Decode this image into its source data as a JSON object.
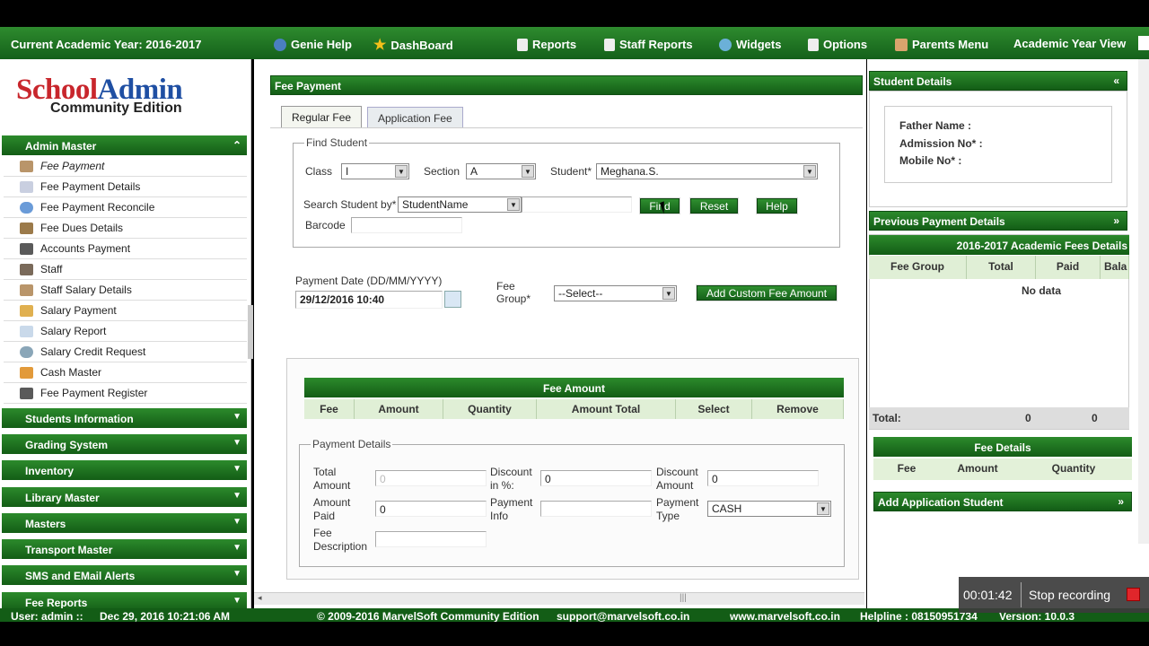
{
  "topbar": {
    "academic_year": "Current Academic Year: 2016-2017",
    "items": [
      {
        "label": "Genie Help",
        "icon": "genie-icon"
      },
      {
        "label": "DashBoard",
        "icon": "star-icon"
      },
      {
        "label": "Reports",
        "icon": "document-icon"
      },
      {
        "label": "Staff Reports",
        "icon": "document-icon"
      },
      {
        "label": "Widgets",
        "icon": "widget-icon"
      },
      {
        "label": "Options",
        "icon": "document-icon"
      },
      {
        "label": "Parents Menu",
        "icon": "parents-icon"
      },
      {
        "label": "Academic Year View",
        "icon": ""
      }
    ]
  },
  "logo": {
    "school": "School",
    "admin": "Admin",
    "edition": "Community Edition"
  },
  "sidebar": {
    "open_section": "Admin Master",
    "items": [
      {
        "label": "Fee Payment"
      },
      {
        "label": "Fee Payment Details"
      },
      {
        "label": "Fee Payment Reconcile"
      },
      {
        "label": "Fee Dues Details"
      },
      {
        "label": "Accounts Payment"
      },
      {
        "label": "Staff"
      },
      {
        "label": "Staff Salary Details"
      },
      {
        "label": "Salary Payment"
      },
      {
        "label": "Salary Report"
      },
      {
        "label": "Salary Credit Request"
      },
      {
        "label": "Cash Master"
      },
      {
        "label": "Fee Payment Register"
      }
    ],
    "sections": [
      "Students Information",
      "Grading System",
      "Inventory",
      "Library Master",
      "Masters",
      "Transport Master",
      "SMS and EMail Alerts",
      "Fee Reports"
    ]
  },
  "fee_payment": {
    "title": "Fee Payment",
    "tabs": [
      "Regular Fee",
      "Application Fee"
    ],
    "find_student": {
      "legend": "Find Student",
      "class_label": "Class",
      "class_value": "I",
      "section_label": "Section",
      "section_value": "A",
      "student_label": "Student*",
      "student_value": "Meghana.S.",
      "search_by_label": "Search Student by*",
      "search_by_value": "StudentName",
      "search_text": "",
      "find_button": "Find",
      "reset_button": "Reset",
      "help_button": "Help",
      "barcode_label": "Barcode",
      "barcode_value": ""
    },
    "payment_date_label": "Payment Date (DD/MM/YYYY)",
    "payment_date_value": "29/12/2016 10:40",
    "fee_group_label": "Fee Group*",
    "fee_group_value": "--Select--",
    "custom_fee_button": "Add Custom Fee Amount",
    "fee_amount_table": {
      "title": "Fee Amount",
      "columns": [
        "Fee",
        "Amount",
        "Quantity",
        "Amount Total",
        "Select",
        "Remove"
      ]
    },
    "payment_details": {
      "legend": "Payment Details",
      "total_amount_label": "Total Amount",
      "total_amount_value": "0",
      "discount_pct_label": "Discount in %:",
      "discount_pct_value": "0",
      "discount_amount_label": "Discount Amount",
      "discount_amount_value": "0",
      "amount_paid_label": "Amount Paid",
      "amount_paid_value": "0",
      "payment_info_label": "Payment Info",
      "payment_info_value": "",
      "payment_type_label": "Payment Type",
      "payment_type_value": "CASH",
      "fee_description_label": "Fee Description",
      "fee_description_value": ""
    }
  },
  "right": {
    "student_details_title": "Student Details",
    "father_name_label": "Father Name :",
    "admission_no_label": "Admission No* :",
    "mobile_no_label": "Mobile No* :",
    "previous_payment_title": "Previous Payment Details",
    "fees_details_title": "2016-2017 Academic Fees Details",
    "prev_columns": [
      "Fee Group",
      "Total",
      "Paid",
      "Bala"
    ],
    "no_data": "No data",
    "total_label": "Total:",
    "total_value": "0",
    "paid_value": "0",
    "fee_details_title": "Fee Details",
    "fee_details_columns": [
      "Fee",
      "Amount",
      "Quantity"
    ],
    "add_application_title": "Add Application Student"
  },
  "statusbar": {
    "user": "User: admin ::",
    "datetime": "Dec 29, 2016 10:21:06 AM",
    "copyright": "© 2009-2016 MarvelSoft Community Edition",
    "email": "support@marvelsoft.co.in",
    "website": "www.marvelsoft.co.in",
    "helpline": "Helpline : 08150951734",
    "version": "Version: 10.0.3"
  },
  "recording": {
    "time": "00:01:42",
    "label": "Stop recording"
  },
  "colors": {
    "brand_green": "#14601a",
    "logo_red": "#c8262c",
    "logo_blue": "#1f4fa3",
    "header_light": "#e0efd6"
  }
}
